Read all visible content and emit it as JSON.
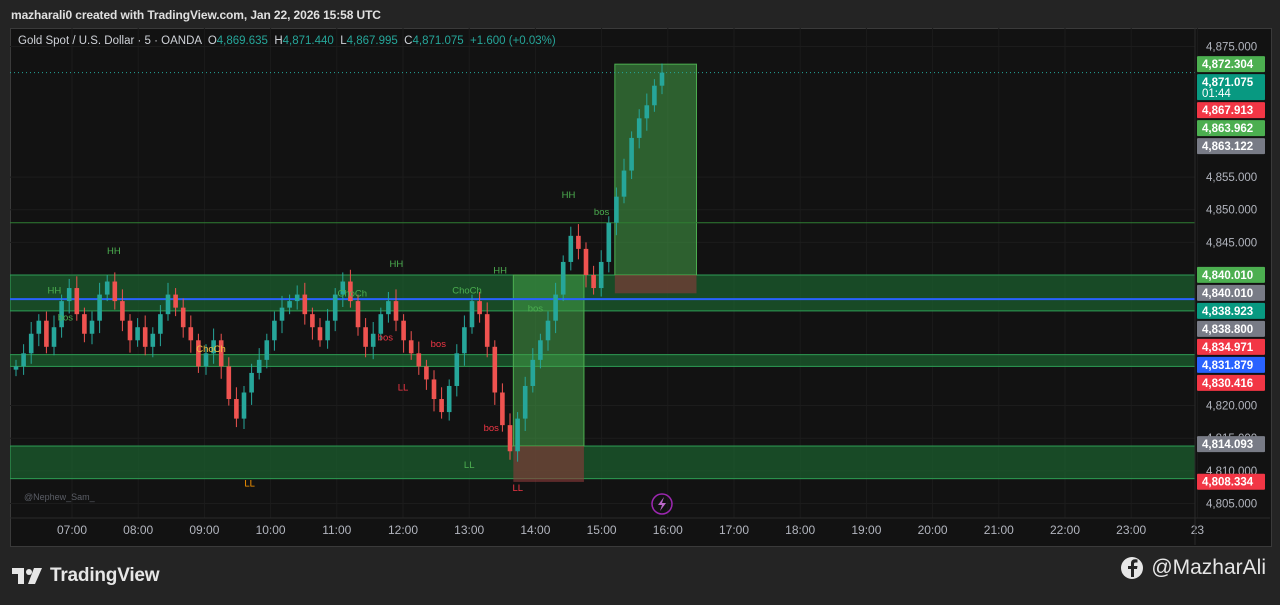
{
  "header": {
    "credit": "mazharali0 created with TradingView.com, Jan 22, 2026 15:58 UTC"
  },
  "legend": {
    "symbol": "Gold Spot / U.S. Dollar · 5 · OANDA",
    "o_label": "O",
    "o_value": "4,869.635",
    "h_label": "H",
    "h_value": "4,871.440",
    "l_label": "L",
    "l_value": "4,867.995",
    "c_label": "C",
    "c_value": "4,871.075",
    "change": "+1.600 (+0.03%)"
  },
  "colors": {
    "up": "#26a69a",
    "down": "#ef5350",
    "zone": "#1f6b3a",
    "blue_line": "#2962ff",
    "label_green": "#4caf50",
    "label_red": "#f23645",
    "label_gray": "#787b86",
    "label_blue": "#2962ff"
  },
  "chart_data": {
    "type": "candlestick",
    "symbol": "Gold Spot / U.S. Dollar",
    "timeframe": "5",
    "ylim": [
      4804,
      4876
    ],
    "x_ticks": [
      "07:00",
      "08:00",
      "09:00",
      "10:00",
      "11:00",
      "12:00",
      "13:00",
      "14:00",
      "15:00",
      "16:00",
      "17:00",
      "18:00",
      "19:00",
      "20:00",
      "21:00",
      "22:00",
      "23:00",
      "23"
    ],
    "y_ticks": [
      {
        "value": 4875,
        "label": "4,875.000"
      },
      {
        "value": 4855,
        "label": "4,855.000"
      },
      {
        "value": 4850,
        "label": "4,850.000"
      },
      {
        "value": 4845,
        "label": "4,845.000"
      },
      {
        "value": 4820,
        "label": "4,820.000"
      },
      {
        "value": 4815,
        "label": "4,815.000"
      },
      {
        "value": 4810,
        "label": "4,810.000"
      },
      {
        "value": 4805,
        "label": "4,805.000"
      }
    ],
    "series_close": [
      4826,
      4828,
      4831,
      4833,
      4829,
      4832,
      4836,
      4838,
      4834,
      4831,
      4833,
      4837,
      4839,
      4836,
      4833,
      4830,
      4832,
      4829,
      4831,
      4834,
      4837,
      4835,
      4832,
      4830,
      4826,
      4828,
      4830,
      4826,
      4821,
      4818,
      4822,
      4825,
      4827,
      4830,
      4833,
      4835,
      4836,
      4837,
      4834,
      4832,
      4830,
      4833,
      4837,
      4839,
      4836,
      4832,
      4829,
      4831,
      4834,
      4836,
      4833,
      4830,
      4828,
      4826,
      4824,
      4821,
      4819,
      4823,
      4828,
      4832,
      4836,
      4834,
      4829,
      4822,
      4817,
      4813,
      4818,
      4823,
      4827,
      4830,
      4833,
      4837,
      4842,
      4846,
      4844,
      4840,
      4838,
      4842,
      4848,
      4852,
      4856,
      4861,
      4864,
      4866,
      4869,
      4871
    ],
    "price_labels": [
      {
        "value": 4872.304,
        "label": "4,872.304",
        "color": "#4caf50"
      },
      {
        "value": 4871.075,
        "label": "4,871.075",
        "sub": "01:44",
        "color": "#089981"
      },
      {
        "value": 4867.913,
        "label": "4,867.913",
        "color": "#f23645"
      },
      {
        "value": 4863.962,
        "label": "4,863.962",
        "color": "#4caf50"
      },
      {
        "value": 4863.122,
        "label": "4,863.122",
        "color": "#787b86"
      },
      {
        "value": 4840.01,
        "label": "4,840.010",
        "color": "#4caf50"
      },
      {
        "value": 4840.01,
        "label": "4,840.010",
        "color": "#787b86"
      },
      {
        "value": 4838.923,
        "label": "4,838.923",
        "color": "#089981"
      },
      {
        "value": 4838.8,
        "label": "4,838.800",
        "color": "#787b86"
      },
      {
        "value": 4834.971,
        "label": "4,834.971",
        "color": "#f23645"
      },
      {
        "value": 4831.879,
        "label": "4,831.879",
        "color": "#2962ff"
      },
      {
        "value": 4830.416,
        "label": "4,830.416",
        "color": "#f23645"
      },
      {
        "value": 4814.093,
        "label": "4,814.093",
        "color": "#787b86"
      },
      {
        "value": 4808.334,
        "label": "4,808.334",
        "color": "#f23645"
      }
    ],
    "zones": [
      {
        "y_top": 4840.0,
        "y_bottom": 4834.5,
        "kind": "supply"
      },
      {
        "y_top": 4827.8,
        "y_bottom": 4826.0,
        "kind": "support"
      },
      {
        "y_top": 4813.8,
        "y_bottom": 4808.8,
        "kind": "demand"
      }
    ],
    "horizontal_lines": [
      {
        "value": 4848.0,
        "color": "#2e7d32"
      },
      {
        "value": 4836.3,
        "color": "#2962ff"
      }
    ],
    "annotations": [
      {
        "text": "HH",
        "x": "07:38",
        "y": 4843.2,
        "color": "#4caf50"
      },
      {
        "text": "HH",
        "x": "06:44",
        "y": 4837.2,
        "color": "#4caf50"
      },
      {
        "text": "bos",
        "x": "06:54",
        "y": 4833.0,
        "color": "#4caf50"
      },
      {
        "text": "ChoCh",
        "x": "09:06",
        "y": 4828.2,
        "color": "#f0c040"
      },
      {
        "text": "LL",
        "x": "09:41",
        "y": 4807.6,
        "color": "#ff9800"
      },
      {
        "text": "HH",
        "x": "11:54",
        "y": 4841.2,
        "color": "#4caf50"
      },
      {
        "text": "ChoCh",
        "x": "11:14",
        "y": 4836.7,
        "color": "#4caf50"
      },
      {
        "text": "bos",
        "x": "11:44",
        "y": 4830.0,
        "color": "#f23645"
      },
      {
        "text": "LL",
        "x": "12:00",
        "y": 4822.3,
        "color": "#f23645"
      },
      {
        "text": "bos",
        "x": "12:32",
        "y": 4829.0,
        "color": "#f23645"
      },
      {
        "text": "ChoCh",
        "x": "12:58",
        "y": 4837.2,
        "color": "#4caf50"
      },
      {
        "text": "HH",
        "x": "13:28",
        "y": 4840.2,
        "color": "#4caf50"
      },
      {
        "text": "bos",
        "x": "14:00",
        "y": 4834.4,
        "color": "#4caf50"
      },
      {
        "text": "bos",
        "x": "13:20",
        "y": 4816.1,
        "color": "#f23645"
      },
      {
        "text": "LL",
        "x": "13:00",
        "y": 4810.4,
        "color": "#4caf50"
      },
      {
        "text": "LL",
        "x": "13:44",
        "y": 4806.9,
        "color": "#f23645"
      },
      {
        "text": "HH",
        "x": "14:30",
        "y": 4851.8,
        "color": "#4caf50"
      },
      {
        "text": "bos",
        "x": "15:00",
        "y": 4849.2,
        "color": "#4caf50"
      }
    ],
    "watermark": "@Nephew_Sam_"
  },
  "footer": {
    "brand": "TradingView",
    "handle": "@MazharAli"
  },
  "icons": {
    "lightning": "lightning-icon",
    "facebook": "facebook-icon",
    "tv_logo": "tradingview-logo-icon"
  }
}
